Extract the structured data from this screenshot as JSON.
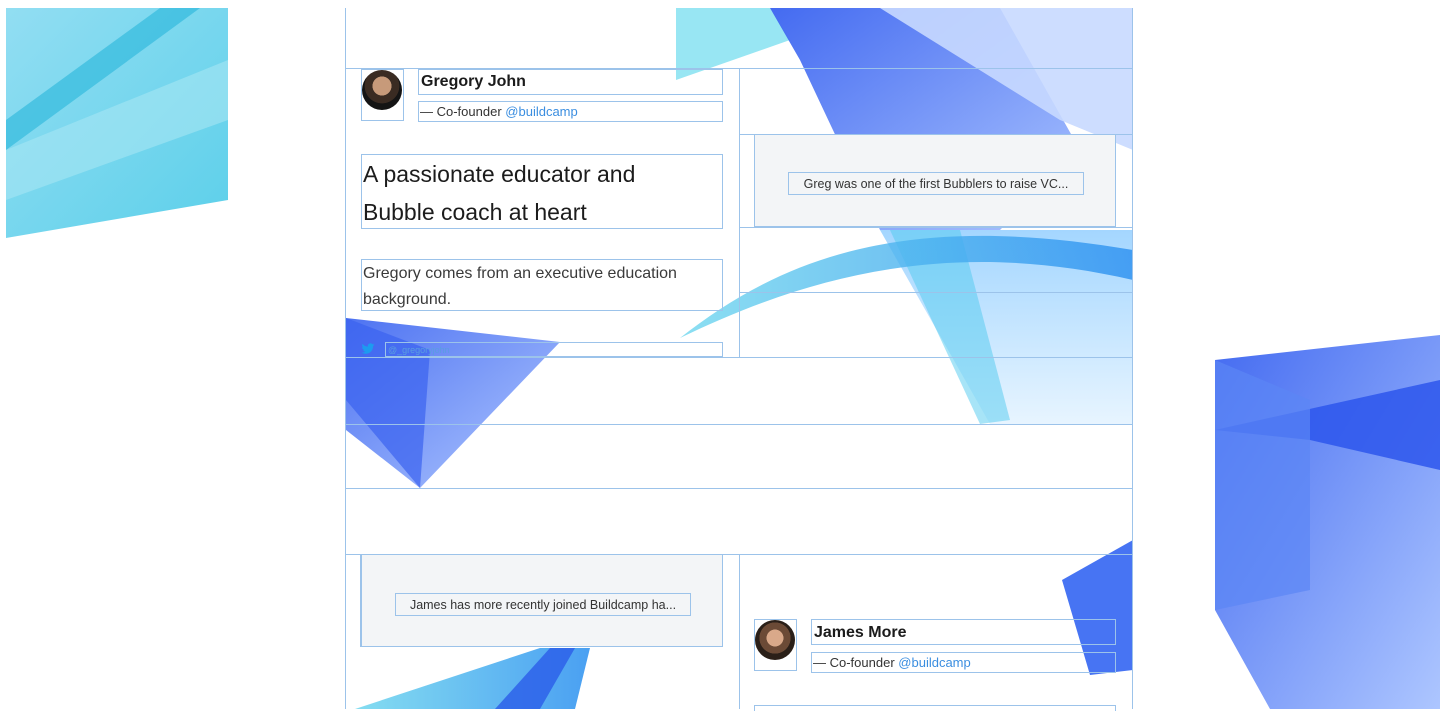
{
  "profiles": [
    {
      "name": "Gregory John",
      "role_prefix": "— Co-founder",
      "role_handle": "@buildcamp",
      "headline_line1": "A passionate educator and",
      "headline_line2": "Bubble coach at heart",
      "description_line1": "Gregory comes from an executive education",
      "description_line2": "background.",
      "twitter_handle": "@_gregoryjohn",
      "quote": "Greg was one of the first Bubblers to raise VC..."
    },
    {
      "name": "James More",
      "role_prefix": "— Co-founder",
      "role_handle": "@buildcamp",
      "quote": "James has more recently joined Buildcamp ha..."
    }
  ],
  "colors": {
    "guide": "#9cc3ea",
    "accent_blue": "#3b8ee0",
    "shape_blue": "#3d6df2",
    "shape_cyan": "#3fd0e8",
    "card_bg": "#f3f5f7"
  },
  "icons": [
    "twitter-icon",
    "avatar-gregory",
    "avatar-james"
  ]
}
